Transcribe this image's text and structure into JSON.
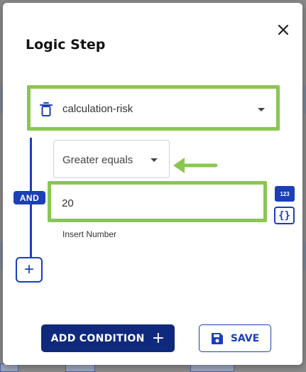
{
  "dialog": {
    "title": "Logic Step",
    "close_icon": "close-icon"
  },
  "field": {
    "value": "calculation-risk",
    "delete_icon": "trash-icon",
    "dropdown_icon": "caret-down-icon"
  },
  "condition": {
    "connector_label": "AND",
    "operator": "Greater equals",
    "value": "20",
    "helper_text": "Insert Number",
    "type_badge": "123",
    "variable_button_icon": "braces-icon",
    "add_branch_icon": "plus-icon"
  },
  "footer": {
    "add_condition_label": "ADD CONDITION",
    "add_condition_icon": "plus-icon",
    "save_label": "SAVE",
    "save_icon": "floppy-disk-icon"
  },
  "colors": {
    "primary": "#1a3fb8",
    "primary_dark": "#0f2a7c",
    "highlight": "#8ac651",
    "text": "#333333"
  }
}
